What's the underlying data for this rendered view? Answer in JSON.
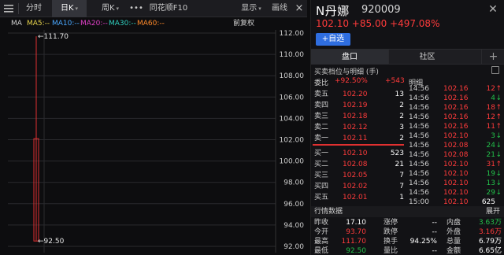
{
  "toolbar": {
    "icon": "list-icon",
    "tabs": [
      "分时",
      "日K",
      "周K",
      "•••",
      "同花顺F10"
    ],
    "display_label": "显示",
    "draw_label": "画线",
    "close_glyph": "×"
  },
  "ma_bar": {
    "ma_label": "MA",
    "ma5": "MA5:--",
    "ma10": "MA10:--",
    "ma20": "MA20:--",
    "ma30": "MA30:--",
    "ma60": "MA60:--",
    "adjust": "前复权",
    "colors": {
      "ma5": "#e8d44d",
      "ma10": "#4aa8ff",
      "ma20": "#e040c8",
      "ma30": "#2fd0c0",
      "ma60": "#ff8a2a"
    }
  },
  "chart_data": {
    "type": "candlestick",
    "y_ticks": [
      "112.00",
      "110.00",
      "108.00",
      "106.00",
      "104.00",
      "102.00",
      "100.00",
      "98.00",
      "96.00",
      "94.00",
      "92.00"
    ],
    "ylim": [
      92,
      112
    ],
    "candles": [
      {
        "open": 92.5,
        "close": 102.1,
        "high": 111.7,
        "low": 92.5
      }
    ],
    "annotations": {
      "high_label": "111.70",
      "low_label": "92.50"
    },
    "colors": {
      "up": "#e03030",
      "grid": "#2a2a2e",
      "axis_text": "#cfcfcf"
    }
  },
  "quote": {
    "name": "N丹娜",
    "code": "920009",
    "price_line": "102.10 +85.00 +497.08%",
    "watch_label": "+自选",
    "close_glyph": "✕"
  },
  "tabs": {
    "items": [
      "盘口",
      "社区"
    ],
    "plus": "+"
  },
  "orderbook": {
    "title": "买卖档位与明细 (手)",
    "ratio_label": "委比",
    "ratio_value": "+92.50%",
    "ratio_diff": "+543",
    "ticks_header": "明细",
    "asks": [
      {
        "label": "卖五",
        "price": "102.20",
        "vol": "13"
      },
      {
        "label": "卖四",
        "price": "102.19",
        "vol": "2"
      },
      {
        "label": "卖三",
        "price": "102.18",
        "vol": "2"
      },
      {
        "label": "卖二",
        "price": "102.12",
        "vol": "3"
      },
      {
        "label": "卖一",
        "price": "102.11",
        "vol": "2"
      }
    ],
    "bids": [
      {
        "label": "买一",
        "price": "102.10",
        "vol": "523"
      },
      {
        "label": "买二",
        "price": "102.08",
        "vol": "21"
      },
      {
        "label": "买三",
        "price": "102.05",
        "vol": "7"
      },
      {
        "label": "买四",
        "price": "102.02",
        "vol": "7"
      },
      {
        "label": "买五",
        "price": "102.01",
        "vol": "1"
      }
    ]
  },
  "ticks": [
    {
      "time": "14:56",
      "price": "102.16",
      "vol": "12",
      "dir": "up"
    },
    {
      "time": "14:56",
      "price": "102.16",
      "vol": "4",
      "dir": "down"
    },
    {
      "time": "14:56",
      "price": "102.16",
      "vol": "18",
      "dir": "up"
    },
    {
      "time": "14:56",
      "price": "102.16",
      "vol": "12",
      "dir": "up"
    },
    {
      "time": "14:56",
      "price": "102.16",
      "vol": "11",
      "dir": "up"
    },
    {
      "time": "14:56",
      "price": "102.10",
      "vol": "3",
      "dir": "down"
    },
    {
      "time": "14:56",
      "price": "102.08",
      "vol": "24",
      "dir": "down"
    },
    {
      "time": "14:56",
      "price": "102.08",
      "vol": "21",
      "dir": "down"
    },
    {
      "time": "14:56",
      "price": "102.10",
      "vol": "31",
      "dir": "up"
    },
    {
      "time": "14:56",
      "price": "102.10",
      "vol": "19",
      "dir": "down"
    },
    {
      "time": "14:56",
      "price": "102.10",
      "vol": "13",
      "dir": "down"
    },
    {
      "time": "14:56",
      "price": "102.10",
      "vol": "29",
      "dir": "down"
    },
    {
      "time": "15:00",
      "price": "102.10",
      "vol": "625",
      "dir": "none"
    }
  ],
  "quote_data": {
    "title": "行情数据",
    "expand": "展开",
    "rows": [
      {
        "l1": "昨收",
        "v1": "17.10",
        "l2": "涨停",
        "v2": "--",
        "l3": "内盘",
        "v3": "3.63万"
      },
      {
        "l1": "今开",
        "v1": "93.70",
        "l2": "跌停",
        "v2": "--",
        "l3": "外盘",
        "v3": "3.16万"
      },
      {
        "l1": "最高",
        "v1": "111.70",
        "l2": "换手",
        "v2": "94.25%",
        "l3": "总量",
        "v3": "6.79万"
      },
      {
        "l1": "最低",
        "v1": "92.50",
        "l2": "量比",
        "v2": "--",
        "l3": "金额",
        "v3": "6.65亿"
      }
    ]
  }
}
